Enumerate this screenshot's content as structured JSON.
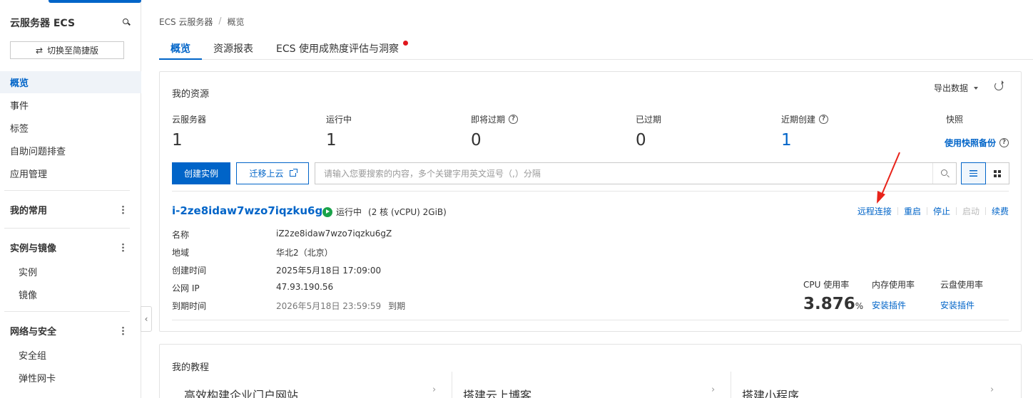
{
  "sidebar": {
    "title": "云服务器 ECS",
    "switch_label": "切换至简捷版",
    "items": [
      {
        "label": "概览"
      },
      {
        "label": "事件"
      },
      {
        "label": "标签"
      },
      {
        "label": "自助问题排查"
      },
      {
        "label": "应用管理"
      }
    ],
    "groups": {
      "common": "我的常用",
      "instance_image": "实例与镜像",
      "instance": "实例",
      "image": "镜像",
      "network_security": "网络与安全",
      "security_group": "安全组",
      "eni": "弹性网卡"
    }
  },
  "breadcrumb": {
    "root": "ECS 云服务器",
    "sep": "/",
    "current": "概览"
  },
  "tabs": [
    {
      "label": "概览",
      "active": true
    },
    {
      "label": "资源报表"
    },
    {
      "label": "ECS 使用成熟度评估与洞察"
    }
  ],
  "resources": {
    "title": "我的资源",
    "export_label": "导出数据",
    "stats": [
      {
        "label": "云服务器",
        "value": "1"
      },
      {
        "label": "运行中",
        "value": "1"
      },
      {
        "label": "即将过期",
        "value": "0"
      },
      {
        "label": "已过期",
        "value": "0"
      },
      {
        "label": "近期创建",
        "value": "1"
      },
      {
        "label": "快照"
      }
    ],
    "snapshot_link": "使用快照备份",
    "create_button": "创建实例",
    "migrate_button": "迁移上云",
    "search_placeholder": "请输入您要搜索的内容，多个关键字用英文逗号（,）分隔"
  },
  "instance": {
    "id": "i-2ze8idaw7wzo7iqzku6g",
    "status": "运行中",
    "spec": "(2 核 (vCPU) 2GiB)",
    "actions": {
      "remote": "远程连接",
      "restart": "重启",
      "stop": "停止",
      "start": "启动",
      "renew": "续费"
    },
    "details": [
      {
        "key": "名称",
        "value": "iZ2ze8idaw7wzo7iqzku6gZ"
      },
      {
        "key": "地域",
        "value": "华北2（北京）"
      },
      {
        "key": "创建时间",
        "value": "2025年5月18日 17:09:00"
      },
      {
        "key": "公网 IP",
        "value": "47.93.190.56"
      },
      {
        "key": "到期时间",
        "value": "2026年5月18日 23:59:59",
        "tag": "到期"
      }
    ],
    "metrics": {
      "cpu_label": "CPU 使用率",
      "cpu_value": "3.876",
      "cpu_unit": "%",
      "mem_label": "内存使用率",
      "mem_link": "安装插件",
      "disk_label": "云盘使用率",
      "disk_link": "安装插件"
    }
  },
  "tutorials": {
    "title": "我的教程",
    "items": [
      {
        "label": "高效构建企业门户网站"
      },
      {
        "label": "搭建云上博客"
      },
      {
        "label": "搭建小程序"
      }
    ]
  },
  "colors": {
    "accent": "#0064c8",
    "running": "#1aa34a",
    "alert": "#e0161d",
    "annotation_arrow": "#e8231a"
  }
}
